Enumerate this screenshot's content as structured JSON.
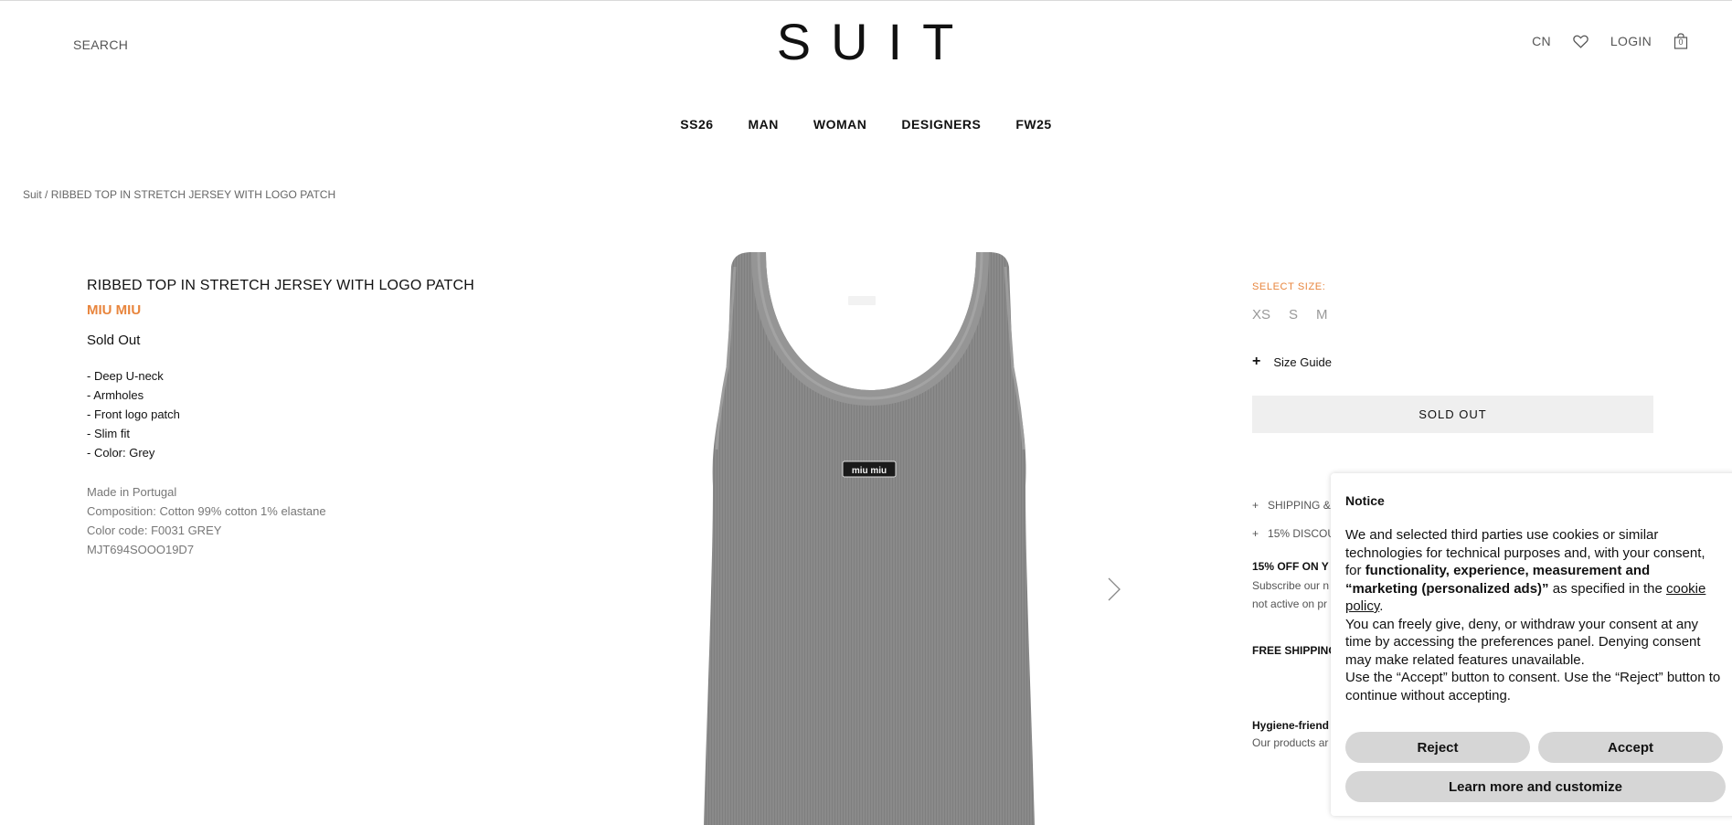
{
  "header": {
    "search_label": "SEARCH",
    "logo": "SUIT",
    "lang": "CN",
    "login": "LOGIN",
    "cart_count": "0"
  },
  "nav": {
    "items": [
      "SS26",
      "MAN",
      "WOMAN",
      "DESIGNERS",
      "FW25"
    ]
  },
  "breadcrumb": {
    "home": "Suit",
    "separator": "/",
    "current": "RIBBED TOP IN STRETCH JERSEY WITH LOGO PATCH"
  },
  "product": {
    "title": "RIBBED TOP IN STRETCH JERSEY WITH LOGO PATCH",
    "brand": "MIU MIU",
    "status": "Sold Out",
    "features": [
      "- Deep U-neck",
      "- Armholes",
      "- Front logo patch",
      "- Slim fit",
      "- Color: Grey"
    ],
    "made_in": "Made in Portugal",
    "composition": "Composition: Cotton 99% cotton 1% elastane",
    "color_code": "Color code: F0031 GREY",
    "sku": "MJT694SOOO19D7",
    "patch_text": "miu miu"
  },
  "purchase": {
    "select_size_label": "SELECT SIZE:",
    "sizes": [
      "XS",
      "S",
      "M"
    ],
    "size_guide": "Size Guide",
    "size_guide_icon": "+",
    "sold_out_button": "SOLD OUT",
    "accordion": [
      {
        "icon": "+",
        "label": "SHIPPING &"
      },
      {
        "icon": "+",
        "label": "15% DISCOU"
      }
    ],
    "promo_title": "15% OFF ON Y",
    "promo_line1": "Subscribe our n",
    "promo_line2": "not active on pr",
    "free_shipping": "FREE SHIPPING",
    "hygiene_title": "Hygiene-friend",
    "hygiene_text": "Our products ar"
  },
  "notice": {
    "title": "Notice",
    "p1_a": "We and selected third parties use cookies or similar technologies for technical purposes and, with your consent, for ",
    "p1_bold": "functionality, experience, measurement and “marketing (personalized ads)”",
    "p1_b": " as specified in the ",
    "p1_link": "cookie policy",
    "p1_c": ".",
    "p2": "You can freely give, deny, or withdraw your consent at any time by accessing the preferences panel. Denying consent may make related features unavailable.",
    "p3": "Use the “Accept” button to consent. Use the “Reject” button to continue without accepting.",
    "reject": "Reject",
    "accept": "Accept",
    "customize": "Learn more and customize"
  },
  "colors": {
    "accent": "#e8853d",
    "garment": "#8a8a8a"
  }
}
